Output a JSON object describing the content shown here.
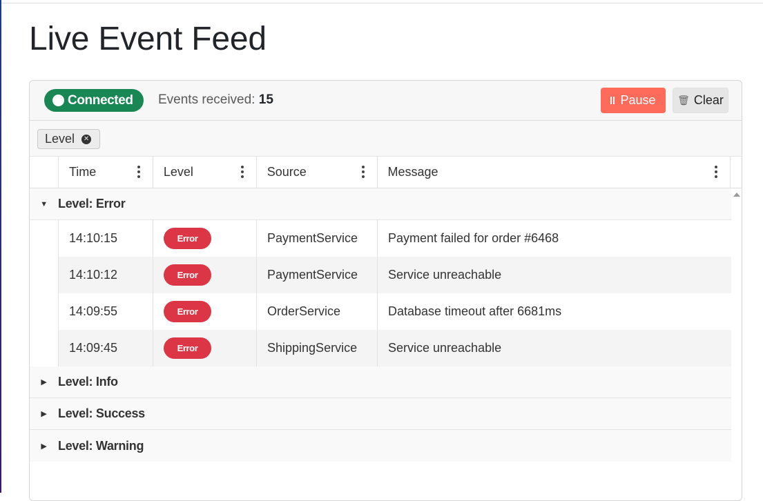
{
  "page": {
    "title": "Live Event Feed"
  },
  "header": {
    "status_label": "Connected",
    "events_label": "Events received:",
    "events_count": "15",
    "pause_label": "Pause",
    "clear_label": "Clear"
  },
  "grouping": {
    "chip_label": "Level"
  },
  "columns": {
    "time": "Time",
    "level": "Level",
    "source": "Source",
    "message": "Message"
  },
  "groups": [
    {
      "label": "Level: Error",
      "expanded": true
    },
    {
      "label": "Level: Info",
      "expanded": false
    },
    {
      "label": "Level: Success",
      "expanded": false
    },
    {
      "label": "Level: Warning",
      "expanded": false
    }
  ],
  "rows": [
    {
      "time": "14:10:15",
      "level": "Error",
      "source": "PaymentService",
      "message": "Payment failed for order #6468"
    },
    {
      "time": "14:10:12",
      "level": "Error",
      "source": "PaymentService",
      "message": "Service unreachable"
    },
    {
      "time": "14:09:55",
      "level": "Error",
      "source": "OrderService",
      "message": "Database timeout after 6681ms"
    },
    {
      "time": "14:09:45",
      "level": "Error",
      "source": "ShippingService",
      "message": "Service unreachable"
    }
  ],
  "colors": {
    "connected": "#198754",
    "pause": "#ff6b5b",
    "error_pill": "#dc3545"
  },
  "icons": {
    "status": "dot-icon",
    "pause": "pause-icon",
    "clear": "trash-icon",
    "chip_remove": "close-circle-icon",
    "column_menu": "kebab-menu-icon",
    "expanded": "caret-down-icon",
    "collapsed": "caret-right-icon"
  }
}
